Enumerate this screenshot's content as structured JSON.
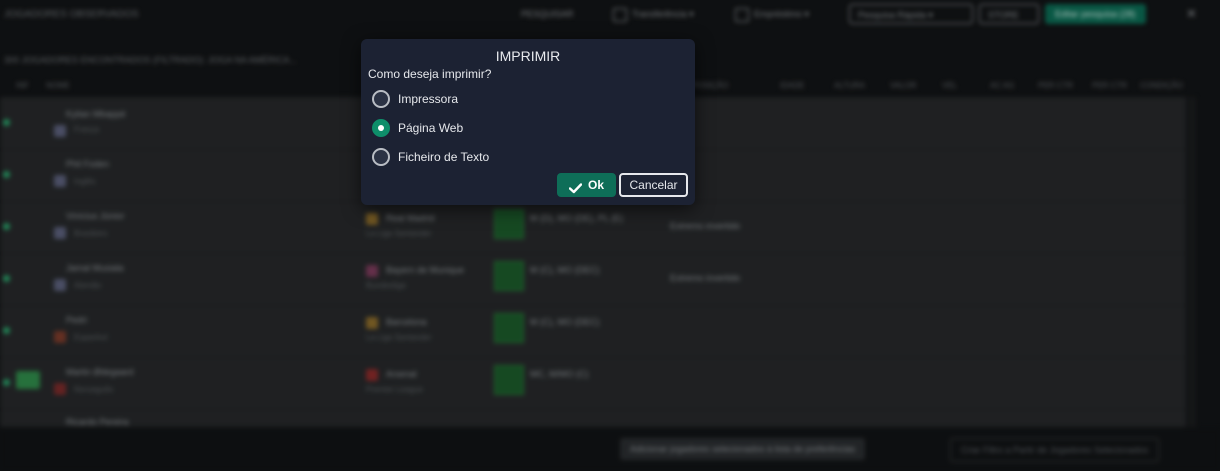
{
  "background": {
    "title": "JOGADORES OBSERVADOS",
    "toolbar": {
      "search_label": "PESQUISAR",
      "opt1": "Transferência",
      "opt2": "Empréstimo",
      "quick_search": "Pesquisa Rápida",
      "store": "STORE",
      "edit_button": "Editar pesquisa (28)"
    },
    "filters": "300 JOGADORES ENCONTRADOS (FILTRADO): JOGA NA AMÉRICA...",
    "columns": [
      "INF",
      "NOME",
      "POSIÇÃO",
      "IDADE",
      "ALTURA",
      "VALOR",
      "VEL",
      "AC AG",
      "PER CTR",
      "PER CTR",
      "CONDIÇÃO"
    ],
    "rows": [
      {
        "name": "Kylian Mbappé",
        "nation": "França"
      },
      {
        "name": "Phil Foden",
        "nation": "Inglês"
      },
      {
        "name": "Vinícius Júnior",
        "nation": "Brasileiro",
        "club": "Real Madrid",
        "league": "La Liga Santander",
        "position": "M (D), MO (DE), PL (E)",
        "role": "Extremo invertido"
      },
      {
        "name": "Jamal Musiala",
        "nation": "Alemão",
        "club": "Bayern de Munique",
        "league": "Bundesliga",
        "position": "M (C), MO (DEC)",
        "role": "Extremo invertido"
      },
      {
        "name": "Pedri",
        "nation": "Espanhol",
        "club": "Barcelona",
        "league": "La Liga Santander",
        "position": "M (C), MO (DEC)"
      },
      {
        "name": "Martin Ødegaard",
        "nation": "Norueguês",
        "club": "Arsenal",
        "league": "Premier League",
        "position": "MC, M/MO (C)"
      },
      {
        "name": "Ricardo Pereira"
      }
    ],
    "bottom": {
      "left_button": "Adicionar jogadores selecionados à lista de preferências",
      "right_button": "Criar Filtro a Partir de Jogadores Selecionados"
    }
  },
  "dialog": {
    "title": "IMPRIMIR",
    "question": "Como deseja imprimir?",
    "options": [
      {
        "label": "Impressora",
        "selected": false
      },
      {
        "label": "Página Web",
        "selected": true
      },
      {
        "label": "Ficheiro de Texto",
        "selected": false
      }
    ],
    "ok_label": "Ok",
    "cancel_label": "Cancelar"
  },
  "colors": {
    "dialog_bg": "#1c2233",
    "accent": "#0e8e6a",
    "ok_bg": "#0e6e58"
  }
}
